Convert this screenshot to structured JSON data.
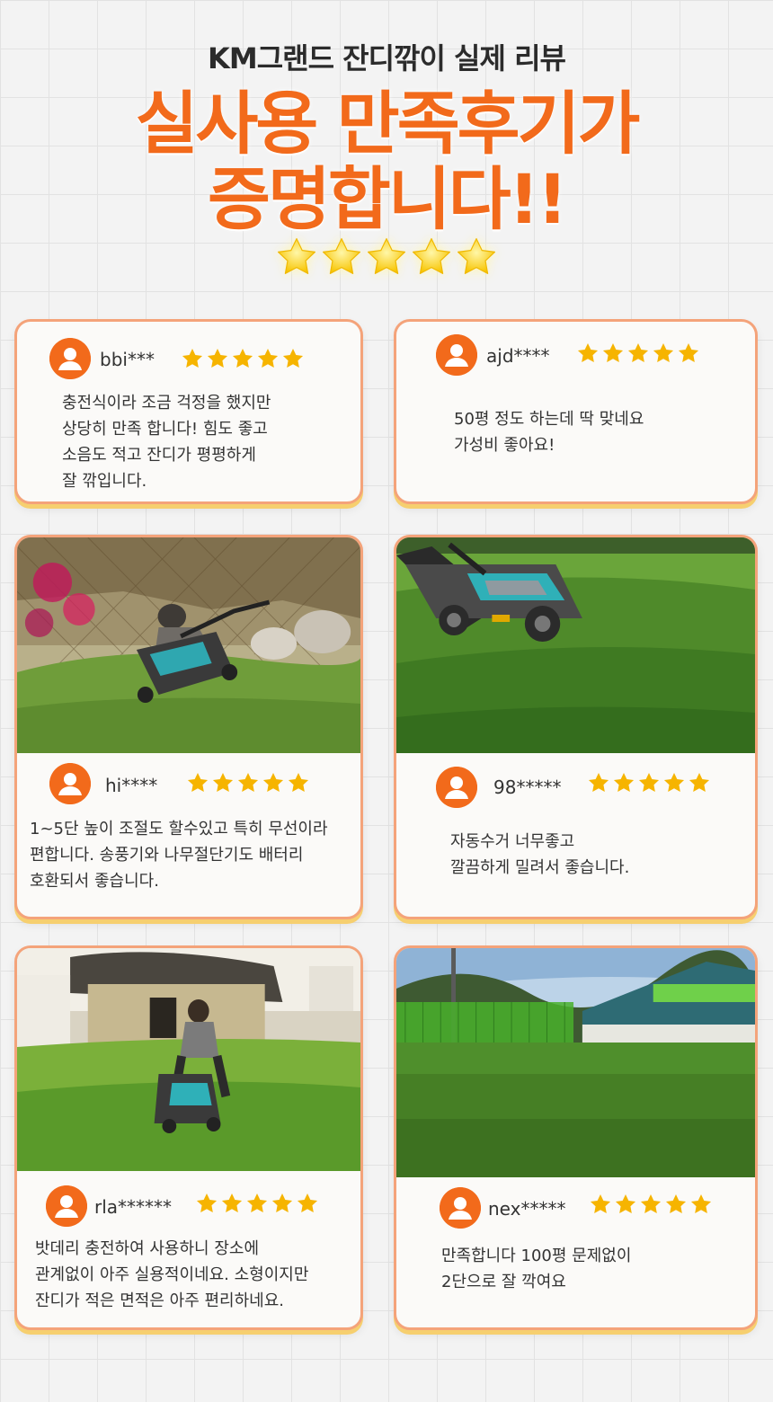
{
  "header": {
    "subtitle": "KM그랜드 잔디깎이 실제 리뷰",
    "headline_line1": "실사용 만족후기가",
    "headline_line2": "증명합니다!!",
    "rating_stars": 5
  },
  "colors": {
    "accent": "#f26a1b",
    "star": "#f6b400",
    "card_border": "#f4a37a",
    "card_shadow": "#f6cf6f"
  },
  "reviews": [
    {
      "user": "bbi***",
      "stars": 5,
      "text": "충전식이라 조금 걱정을 했지만\n상당히 만족 합니다! 힘도 좋고\n소음도 적고 잔디가 평평하게\n잘 깎입니다."
    },
    {
      "user": "ajd****",
      "stars": 5,
      "text": "50평 정도 하는데 딱 맞네요\n가성비 좋아요!"
    },
    {
      "user": "hi****",
      "stars": 5,
      "photo": "man-pushing-lawn-mower-garden-photo",
      "text": "1~5단 높이 조절도 할수있고 특히 무선이라\n편합니다. 송풍기와 나무절단기도 배터리\n호환되서 좋습니다."
    },
    {
      "user": "98*****",
      "stars": 5,
      "photo": "lawn-mower-on-grass-photo",
      "text": "자동수거 너무좋고\n깔끔하게 밀려서 좋습니다."
    },
    {
      "user": "rla******",
      "stars": 5,
      "photo": "man-mowing-yard-photo",
      "text": "밧데리 충전하여 사용하니 장소에\n관계없이 아주 실용적이네요. 소형이지만\n잔디가 적은 면적은 아주 편리하네요."
    },
    {
      "user": "nex*****",
      "stars": 5,
      "photo": "mowed-lawn-with-building-photo",
      "text": "만족합니다 100평 문제없이\n2단으로 잘 깍여요"
    }
  ]
}
